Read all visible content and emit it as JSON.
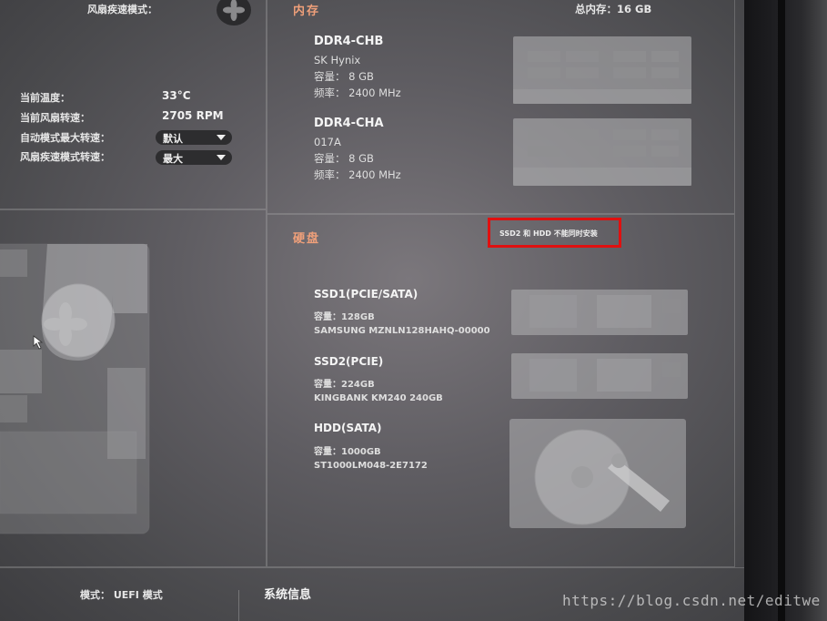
{
  "fan": {
    "header_label": "风扇疾速模式：",
    "rows": [
      {
        "label": "当前温度：",
        "value": "33°C"
      },
      {
        "label": "当前风扇转速：",
        "value": "2705 RPM"
      }
    ],
    "auto_max_label": "自动模式最大转速：",
    "auto_max_value": "默认",
    "turbo_label": "风扇疾速模式转速：",
    "turbo_value": "最大"
  },
  "memory": {
    "title": "内存",
    "total": "总内存：16 GB",
    "modules": [
      {
        "name": "DDR4-CHB",
        "vendor": "SK Hynix",
        "capacity": "容量：  8 GB",
        "frequency": "频率：  2400 MHz"
      },
      {
        "name": "DDR4-CHA",
        "vendor": "017A",
        "capacity": "容量：  8 GB",
        "frequency": "频率：  2400 MHz"
      }
    ]
  },
  "disk": {
    "title": "硬盘",
    "note": "SSD2 和 HDD 不能同时安装",
    "drives": [
      {
        "name": "SSD1(PCIE/SATA)",
        "capacity": "容量：128GB",
        "model": "SAMSUNG MZNLN128HAHQ-00000"
      },
      {
        "name": "SSD2(PCIE)",
        "capacity": "容量：224GB",
        "model": "KINGBANK KM240 240GB"
      },
      {
        "name": "HDD(SATA)",
        "capacity": "容量：1000GB",
        "model": "ST1000LM048-2E7172"
      }
    ]
  },
  "bottom": {
    "mode": "模式：  UEFI 模式",
    "sysinfo": "系统信息"
  },
  "watermark": "https://blog.csdn.net/editwe",
  "colors": {
    "accent": "#f0a07a",
    "highlight": "#e01010"
  }
}
